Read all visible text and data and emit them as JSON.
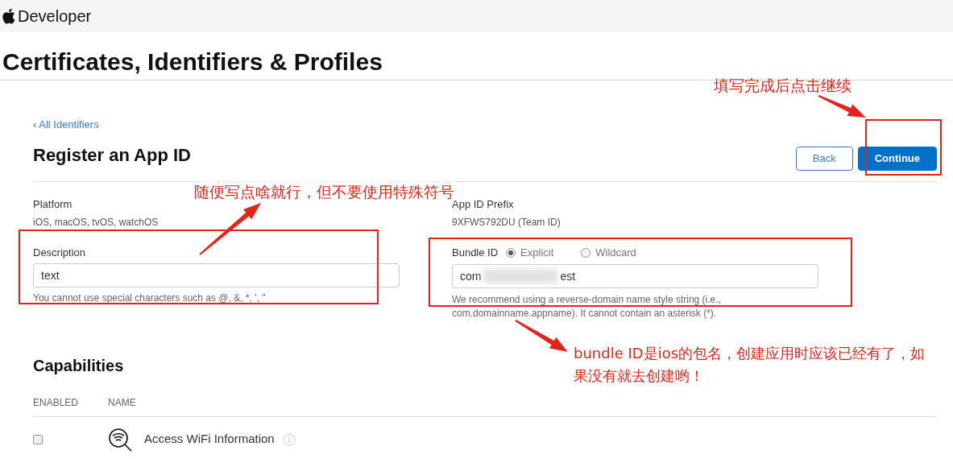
{
  "header": {
    "brand": "Developer"
  },
  "page_title": "Certificates, Identifiers & Profiles",
  "back_link": "‹ All Identifiers",
  "form_title": "Register an App ID",
  "buttons": [
    {
      "label": "Back",
      "kind": "secondary"
    },
    {
      "label": "Continue",
      "kind": "primary"
    }
  ],
  "platform": {
    "label": "Platform",
    "value": "iOS, macOS, tvOS, watchOS"
  },
  "prefix": {
    "label": "App ID Prefix",
    "value": "9XFWS792DU (Team ID)"
  },
  "description": {
    "label": "Description",
    "value": "text",
    "hint": "You cannot use special characters such as @, &, *, ', \""
  },
  "bundle_id": {
    "label": "Bundle ID",
    "options": [
      {
        "label": "Explicit",
        "selected": true
      },
      {
        "label": "Wildcard",
        "selected": false
      }
    ],
    "value_start": "com",
    "value_end": "est",
    "hint": [
      "We recommend using a reverse-domain name style string (i.e.,",
      "com.domainname.appname). It cannot contain an asterisk (*)."
    ]
  },
  "capabilities": {
    "title": "Capabilities",
    "columns": [
      "ENABLED",
      "NAME"
    ],
    "rows": [
      {
        "checked": false,
        "name": "Access WiFi Information"
      }
    ]
  },
  "annotations": [
    "填写完成后点击继续",
    "随便写点啥就行，但不要使用特殊符号",
    "bundle ID是ios的包名，创建应用时应该已经有了，如果没有就去创建哟！"
  ]
}
